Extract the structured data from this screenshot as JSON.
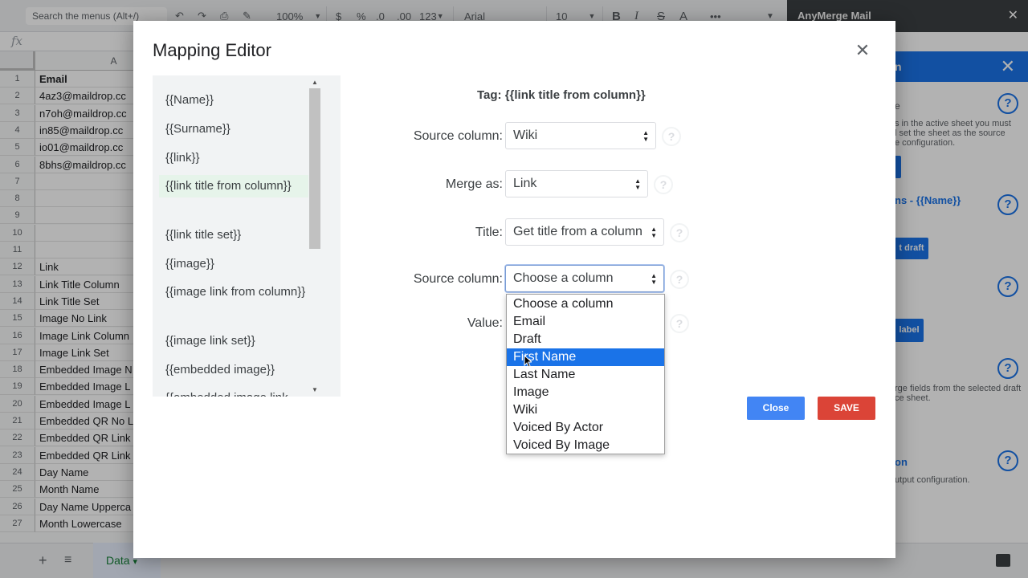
{
  "toolbar": {
    "search_placeholder": "Search the menus (Alt+/)",
    "zoom": "100%",
    "currency": "$",
    "percent": "%",
    "decimal_decrease": ".0",
    "decimal_increase": ".00",
    "more_formats": "123",
    "font": "Arial",
    "font_size": "10",
    "bold": "B",
    "italic": "I",
    "strike": "S",
    "text_color": "A",
    "more": "•••"
  },
  "formula_bar": {
    "fx": "fx"
  },
  "grid": {
    "column_a": "A",
    "rows": [
      {
        "n": "1",
        "value": "Email",
        "bold": true
      },
      {
        "n": "2",
        "value": "4az3@maildrop.cc"
      },
      {
        "n": "3",
        "value": "n7oh@maildrop.cc"
      },
      {
        "n": "4",
        "value": "in85@maildrop.cc"
      },
      {
        "n": "5",
        "value": "io01@maildrop.cc"
      },
      {
        "n": "6",
        "value": "8bhs@maildrop.cc"
      },
      {
        "n": "7",
        "value": ""
      },
      {
        "n": "8",
        "value": ""
      },
      {
        "n": "9",
        "value": ""
      },
      {
        "n": "10",
        "value": ""
      },
      {
        "n": "11",
        "value": ""
      },
      {
        "n": "12",
        "value": "Link"
      },
      {
        "n": "13",
        "value": "Link Title Column"
      },
      {
        "n": "14",
        "value": "Link Title Set"
      },
      {
        "n": "15",
        "value": "Image No Link"
      },
      {
        "n": "16",
        "value": "Image Link Column"
      },
      {
        "n": "17",
        "value": "Image Link Set"
      },
      {
        "n": "18",
        "value": "Embedded Image N"
      },
      {
        "n": "19",
        "value": "Embedded Image L"
      },
      {
        "n": "20",
        "value": "Embedded Image L"
      },
      {
        "n": "21",
        "value": "Embedded QR No L"
      },
      {
        "n": "22",
        "value": "Embedded QR Link"
      },
      {
        "n": "23",
        "value": "Embedded QR Link"
      },
      {
        "n": "24",
        "value": "Day Name"
      },
      {
        "n": "25",
        "value": "Month Name"
      },
      {
        "n": "26",
        "value": "Day Name Upperca"
      },
      {
        "n": "27",
        "value": "Month Lowercase"
      }
    ]
  },
  "sheet_tabs": {
    "add": "+",
    "all_sheets": "≡",
    "active": "Data",
    "caret": "▾"
  },
  "sidebar": {
    "app_name": "AnyMerge Mail",
    "close": "✕",
    "header_fragment": "n",
    "header_close": "✕",
    "help": "?",
    "section1_fragment": "e",
    "text1": [
      "s in the active sheet you must",
      "l set the sheet as the source",
      "e configuration."
    ],
    "section2_title": "ns - {{Name}}",
    "button2": "t draft",
    "button3": "label",
    "text4": [
      "rge fields from the selected draft",
      "ce sheet."
    ],
    "section5_title": "on",
    "text5": "utput configuration."
  },
  "modal": {
    "title": "Mapping Editor",
    "close_icon": "✕",
    "tags": [
      "{{Name}}",
      "{{Surname}}",
      "{{link}}",
      "{{link title from column}}",
      "{{link title set}}",
      "{{image}}",
      "{{image link from column}}",
      "{{image link set}}",
      "{{embedded image}}",
      "{{embedded image link from column}}"
    ],
    "selected_tag_index": 3,
    "scroll_up": "▲",
    "scroll_down": "▼",
    "tag_heading": "Tag: {{link title from column}}",
    "fields": {
      "source_column_label": "Source column:",
      "source_column_value": "Wiki",
      "merge_as_label": "Merge as:",
      "merge_as_value": "Link",
      "title_label": "Title:",
      "title_value": "Get title from a column",
      "title_source_label": "Source column:",
      "title_source_value": "Choose a column",
      "value_label": "Value:"
    },
    "help_glyph": "?",
    "dropdown_options": [
      "Choose a column",
      "Email",
      "Draft",
      "First Name",
      "Last Name",
      "Image",
      "Wiki",
      "Voiced By Actor",
      "Voiced By Image"
    ],
    "highlighted_option": "First Name",
    "close_button": "Close",
    "save_button": "SAVE"
  }
}
